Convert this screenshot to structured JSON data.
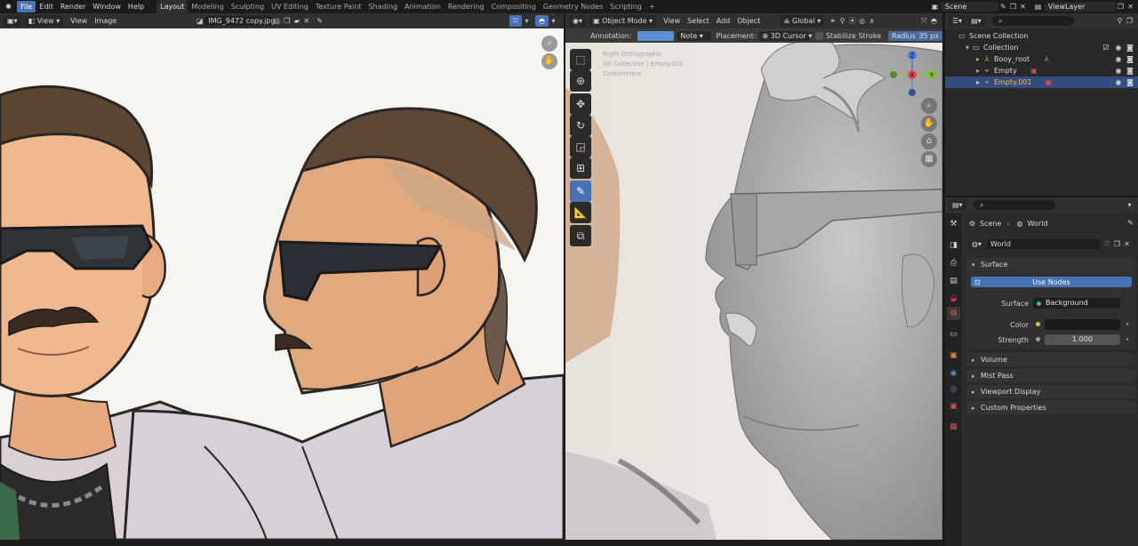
{
  "topbar": {
    "menus": [
      "File",
      "Edit",
      "Render",
      "Window",
      "Help"
    ],
    "workspaces": [
      "Layout",
      "Modeling",
      "Sculpting",
      "UV Editing",
      "Texture Paint",
      "Shading",
      "Animation",
      "Rendering",
      "Compositing",
      "Geometry Nodes",
      "Scripting"
    ],
    "add_symbol": "+",
    "scene": "Scene",
    "view_layer": "ViewLayer"
  },
  "image_editor": {
    "header": {
      "view_mode": "View",
      "view": "View",
      "image": "Image",
      "image_name": "IMG_9472 copy.jpg"
    }
  },
  "viewport": {
    "header": {
      "mode": "Object Mode",
      "view": "View",
      "select": "Select",
      "add": "Add",
      "object": "Object",
      "orientation": "Global"
    },
    "annotation_bar": {
      "annotation_label": "Annotation:",
      "note": "Note",
      "placement_label": "Placement:",
      "placement": "3D Cursor",
      "stabilize": "Stabilize Stroke",
      "radius": "Radius",
      "radius_value": "35 px",
      "color": "#5a8fd0"
    },
    "overlay": {
      "line1": "Right Orthographic",
      "line2": "(0) Collection | Empty.001",
      "line3": "Centimeters"
    },
    "gizmo": {
      "z": "Z",
      "y": "Y",
      "x": "X"
    }
  },
  "outliner": {
    "search_placeholder": "",
    "scene_collection": "Scene Collection",
    "collection": "Collection",
    "items": [
      {
        "name": "Booy_root",
        "selected": false
      },
      {
        "name": "Empty",
        "selected": false
      },
      {
        "name": "Empty.001",
        "selected": true
      }
    ]
  },
  "properties": {
    "breadcrumb": {
      "scene": "Scene",
      "world": "World"
    },
    "world_name": "World",
    "surface_panel": "Surface",
    "use_nodes": "Use Nodes",
    "surface_label": "Surface",
    "surface_value": "Background",
    "color_label": "Color",
    "strength_label": "Strength",
    "strength_value": "1.000",
    "panels": [
      "Volume",
      "Mist Pass",
      "Viewport Display",
      "Custom Properties"
    ]
  }
}
